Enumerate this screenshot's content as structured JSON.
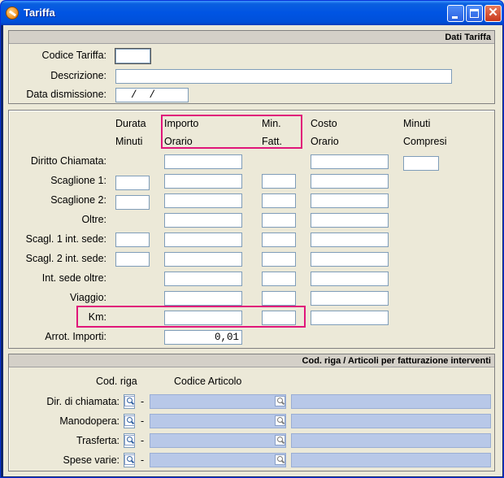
{
  "window": {
    "title": "Tariffa"
  },
  "dati_tariffa": {
    "header": "Dati Tariffa",
    "codice_label": "Codice Tariffa:",
    "codice_value": "",
    "descrizione_label": "Descrizione:",
    "descrizione_value": "",
    "data_label": "Data dismissione:",
    "data_value": "  /  /"
  },
  "tariffe": {
    "col_headers": {
      "durata_1": "Durata",
      "durata_2": "Minuti",
      "importo_1": "Importo",
      "importo_2": "Orario",
      "min_1": "Min.",
      "min_2": "Fatt.",
      "costo_1": "Costo",
      "costo_2": "Orario",
      "minuti_1": "Minuti",
      "minuti_2": "Compresi"
    },
    "rows": [
      {
        "label": "Diritto Chiamata:"
      },
      {
        "label": "Scaglione 1:"
      },
      {
        "label": "Scaglione 2:"
      },
      {
        "label": "Oltre:"
      },
      {
        "label": "Scagl. 1 int. sede:"
      },
      {
        "label": "Scagl. 2 int. sede:"
      },
      {
        "label": "Int. sede oltre:"
      },
      {
        "label": "Viaggio:"
      },
      {
        "label": "Km:"
      }
    ],
    "arrot_label": "Arrot. Importi:",
    "arrot_value": "0,01"
  },
  "articoli": {
    "header": "Cod. riga / Articoli per fatturazione interventi",
    "col_cod_riga": "Cod. riga",
    "col_codice_articolo": "Codice Articolo",
    "dash": "-",
    "rows": [
      {
        "label": "Dir. di chiamata:"
      },
      {
        "label": "Manodopera:"
      },
      {
        "label": "Trasferta:"
      },
      {
        "label": "Spese varie:"
      }
    ]
  },
  "icons": {
    "app": "tariff-app-icon",
    "lookup": "magnifier-icon"
  },
  "colors": {
    "highlight": "#e0167a",
    "titlebar": "#0054e3",
    "disabled_field": "#b8c8e8"
  }
}
